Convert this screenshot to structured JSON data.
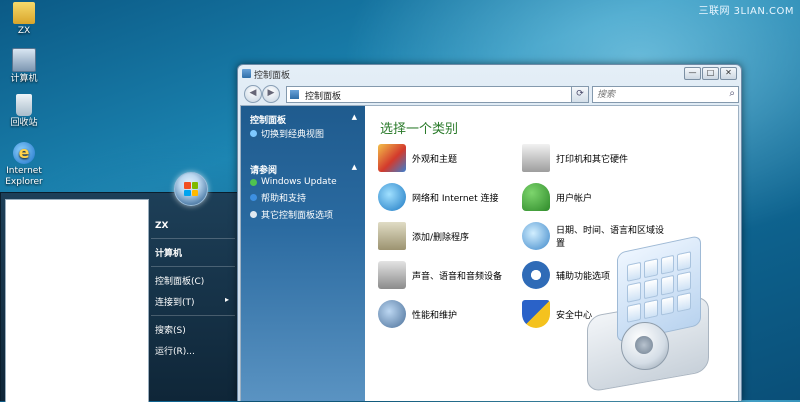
{
  "watermark": "三联网 3LIAN.COM",
  "desktop": {
    "icons": [
      {
        "label": "ZX",
        "icon": "folder-icon"
      },
      {
        "label": "计算机",
        "icon": "computer-icon"
      },
      {
        "label": "回收站",
        "icon": "recycle-bin-icon"
      },
      {
        "label": "Internet Explorer",
        "icon": "internet-explorer-icon"
      }
    ]
  },
  "start_menu": {
    "right_items": [
      {
        "label": "ZX"
      },
      {
        "label": "计算机"
      },
      {
        "label": "控制面板(C)"
      },
      {
        "label": "连接到(T)",
        "has_submenu": true
      },
      {
        "label": "搜索(S)"
      },
      {
        "label": "运行(R)..."
      }
    ]
  },
  "window": {
    "title": "控制面板",
    "address": "控制面板",
    "search_placeholder": "搜索",
    "buttons": {
      "minimize": "—",
      "maximize": "□",
      "close": "✕"
    },
    "nav_pane": {
      "section1_title": "控制面板",
      "section1_links": [
        "切换到经典视图"
      ],
      "section2_title": "请参阅",
      "section2_links": [
        "Windows Update",
        "帮助和支持",
        "其它控制面板选项"
      ]
    },
    "heading": "选择一个类别",
    "categories": [
      {
        "label": "外观和主题",
        "icon": "appearance-icon"
      },
      {
        "label": "打印机和其它硬件",
        "icon": "printer-icon"
      },
      {
        "label": "网络和 Internet 连接",
        "icon": "network-icon"
      },
      {
        "label": "用户帐户",
        "icon": "user-accounts-icon"
      },
      {
        "label": "添加/删除程序",
        "icon": "add-remove-programs-icon"
      },
      {
        "label": "日期、时间、语言和区域设置",
        "icon": "date-time-icon"
      },
      {
        "label": "声音、语音和音频设备",
        "icon": "sound-icon"
      },
      {
        "label": "辅助功能选项",
        "icon": "accessibility-icon"
      },
      {
        "label": "性能和维护",
        "icon": "performance-icon"
      },
      {
        "label": "安全中心",
        "icon": "security-center-icon"
      }
    ]
  },
  "colors": {
    "heading_green": "#2a7a2a",
    "nav_pane_blue": "#1f5b8e"
  }
}
